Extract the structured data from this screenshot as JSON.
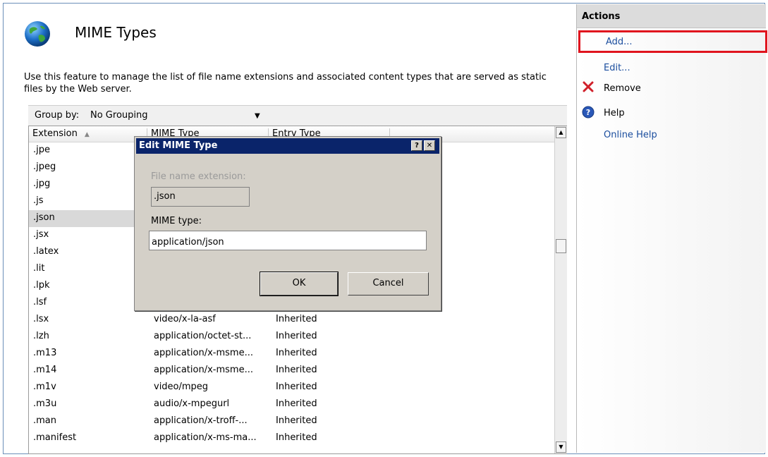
{
  "header": {
    "title": "MIME Types",
    "description": "Use this feature to manage the list of file name extensions and associated content types that are served as static files by the Web server."
  },
  "group_by": {
    "label": "Group by:",
    "value": "No Grouping"
  },
  "columns": [
    "Extension",
    "MIME Type",
    "Entry Type"
  ],
  "rows": [
    {
      "ext": ".jpe",
      "mime": "",
      "entry": ""
    },
    {
      "ext": ".jpeg",
      "mime": "",
      "entry": ""
    },
    {
      "ext": ".jpg",
      "mime": "",
      "entry": ""
    },
    {
      "ext": ".js",
      "mime": "",
      "entry": ""
    },
    {
      "ext": ".json",
      "mime": "",
      "entry": "",
      "selected": true
    },
    {
      "ext": ".jsx",
      "mime": "",
      "entry": ""
    },
    {
      "ext": ".latex",
      "mime": "",
      "entry": ""
    },
    {
      "ext": ".lit",
      "mime": "",
      "entry": ""
    },
    {
      "ext": ".lpk",
      "mime": "",
      "entry": ""
    },
    {
      "ext": ".lsf",
      "mime": "",
      "entry": ""
    },
    {
      "ext": ".lsx",
      "mime": "video/x-la-asf",
      "entry": "Inherited"
    },
    {
      "ext": ".lzh",
      "mime": "application/octet-st...",
      "entry": "Inherited"
    },
    {
      "ext": ".m13",
      "mime": "application/x-msme...",
      "entry": "Inherited"
    },
    {
      "ext": ".m14",
      "mime": "application/x-msme...",
      "entry": "Inherited"
    },
    {
      "ext": ".m1v",
      "mime": "video/mpeg",
      "entry": "Inherited"
    },
    {
      "ext": ".m3u",
      "mime": "audio/x-mpegurl",
      "entry": "Inherited"
    },
    {
      "ext": ".man",
      "mime": "application/x-troff-...",
      "entry": "Inherited"
    },
    {
      "ext": ".manifest",
      "mime": "application/x-ms-ma...",
      "entry": "Inherited"
    }
  ],
  "dialog": {
    "title": "Edit MIME Type",
    "help_glyph": "?",
    "close_glyph": "✕",
    "ext_label": "File name extension:",
    "ext_value": ".json",
    "mime_label": "MIME type:",
    "mime_value": "application/json",
    "ok_label": "OK",
    "cancel_label": "Cancel"
  },
  "actions": {
    "title": "Actions",
    "add": "Add...",
    "edit": "Edit...",
    "remove": "Remove",
    "help": "Help",
    "online_help": "Online Help"
  },
  "colors": {
    "selection_frame": "#e0141e",
    "link": "#1a4d9e",
    "dialog_title_bg": "#0a246a"
  }
}
